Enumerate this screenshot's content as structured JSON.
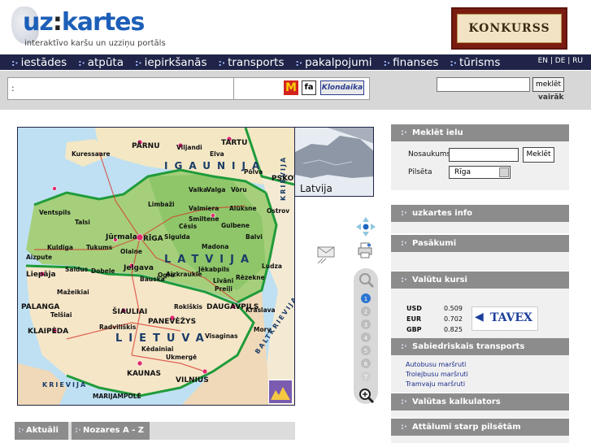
{
  "header": {
    "logo_text": "uzkartes",
    "tagline": "interaktīvo karšu un uzziņu portāls",
    "banner": "KONKURSS"
  },
  "nav": {
    "items": [
      "iestādes",
      "atpūta",
      "iepirkšanās",
      "transports",
      "pakalpojumi",
      "finanses",
      "tūrisms"
    ],
    "langs": "EN | DE | RU"
  },
  "search": {
    "button": "meklēt",
    "more": "vairāk",
    "sponsors": [
      "McDonald's",
      "fa",
      "Klondaika"
    ]
  },
  "map": {
    "countries": [
      "IGAUNIJA",
      "LATVIJA",
      "LIETUVA",
      "KRIEVIJA",
      "BALTKRIEVIJA"
    ],
    "minimap_label": "Latvija",
    "cities": [
      "Kuressaare",
      "PÄRNU",
      "Viljandi",
      "TARTU",
      "Elva",
      "Põlva",
      "PSKOV",
      "Valka",
      "Valga",
      "Võru",
      "Ventspils",
      "Talsi",
      "Limbaži",
      "Valmiera",
      "Alūksne",
      "Ostrov",
      "Smiltene",
      "Cēsis",
      "Gulbene",
      "Jūrmala",
      "RĪGA",
      "Kuldīga",
      "Tukums",
      "Olaine",
      "Sigulda",
      "Balvi",
      "Aizpute",
      "Saldus",
      "Dobele",
      "Jelgava",
      "Ogre",
      "Madona",
      "Liepāja",
      "Bauska",
      "Aizkraukle",
      "Jēkabpils",
      "Rēzekne",
      "Ludza",
      "Mažeikiai",
      "Līvāni",
      "Preiļi",
      "PALANGA",
      "ŠIAULIAI",
      "Rokiškis",
      "DAUGAVPILS",
      "Krāslava",
      "Telšiai",
      "Radviliškis",
      "PANEVĖŽYS",
      "KLAIPĖDA",
      "Visaginas",
      "Mory",
      "Kėdainiai",
      "Ukmergė",
      "KAUNAS",
      "VILNIUS",
      "MARIJAMPOLĖ"
    ]
  },
  "panels": {
    "street_search": {
      "title": "Meklēt ielu",
      "street_label": "Nosaukums",
      "city_label": "Pilsēta",
      "city_value": "Rīga",
      "button": "Meklēt"
    },
    "info": "uzkartes info",
    "events": "Pasākumi",
    "currency": {
      "title": "Valūtu kursi",
      "rates": [
        {
          "code": "USD",
          "value": "0.509"
        },
        {
          "code": "EUR",
          "value": "0.702"
        },
        {
          "code": "GBP",
          "value": "0.825"
        }
      ],
      "sponsor": "TAVEX"
    },
    "transport": {
      "title": "Sabiedriskais transports",
      "links": [
        "Autobusu maršruti",
        "Trolejbusu maršruti",
        "Tramvaju maršruti"
      ]
    },
    "calculator": "Valūtas kalkulators",
    "distances": "Attālumi starp pilsētām"
  },
  "bottom_tabs": [
    "Aktuāli",
    "Nozares A - Z"
  ],
  "colors": {
    "navy": "#1f2448",
    "panel_header": "#8c8c8c",
    "strip": "#d7d7d7",
    "latvia": "#a6cf7b",
    "estonia": "#f3e7c4",
    "lithuania": "#f6e6c8",
    "border_green": "#1f9b3a"
  }
}
